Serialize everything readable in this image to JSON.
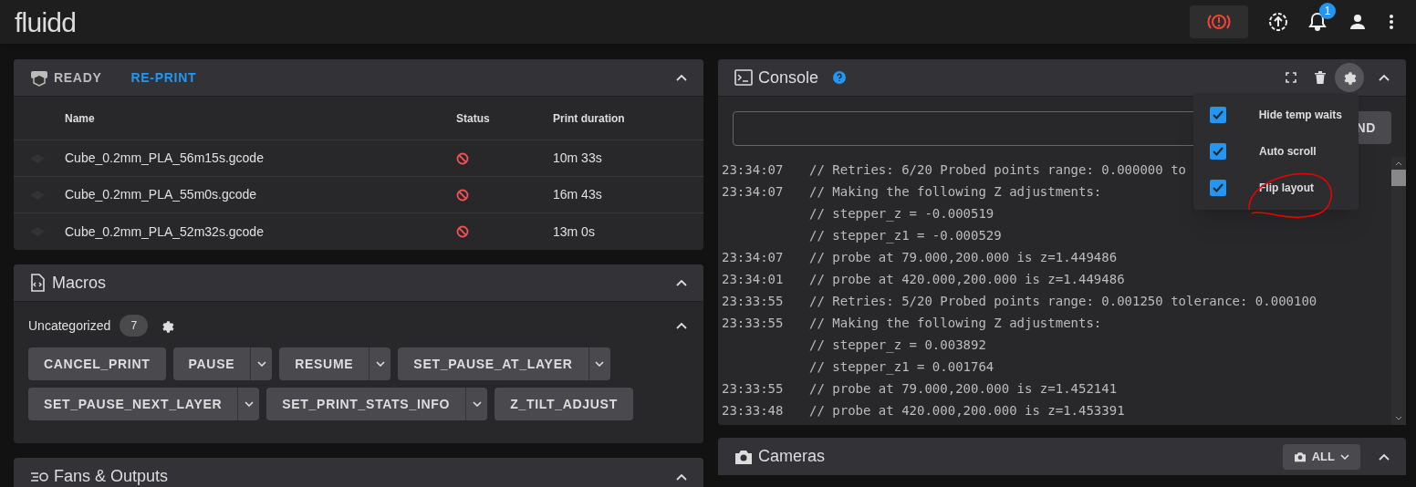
{
  "app_bar": {
    "logo": "fluidd",
    "notification_count": "1"
  },
  "status_card": {
    "title": "READY",
    "action": "RE-PRINT",
    "columns": [
      "Name",
      "Status",
      "Print duration"
    ],
    "rows": [
      {
        "name": "Cube_0.2mm_PLA_56m15s.gcode",
        "duration": "10m 33s"
      },
      {
        "name": "Cube_0.2mm_PLA_55m0s.gcode",
        "duration": "16m 43s"
      },
      {
        "name": "Cube_0.2mm_PLA_52m32s.gcode",
        "duration": "13m 0s"
      }
    ]
  },
  "macros": {
    "title": "Macros",
    "category": "Uncategorized",
    "count": "7",
    "buttons": [
      {
        "label": "CANCEL_PRINT",
        "menu": false
      },
      {
        "label": "PAUSE",
        "menu": true
      },
      {
        "label": "RESUME",
        "menu": true
      },
      {
        "label": "SET_PAUSE_AT_LAYER",
        "menu": true
      },
      {
        "label": "SET_PAUSE_NEXT_LAYER",
        "menu": true
      },
      {
        "label": "SET_PRINT_STATS_INFO",
        "menu": true
      },
      {
        "label": "Z_TILT_ADJUST",
        "menu": false
      }
    ]
  },
  "fans": {
    "title": "Fans & Outputs"
  },
  "console": {
    "title": "Console",
    "send": "ND",
    "lines": [
      {
        "time": "23:34:07",
        "text": "// Retries: 6/20 Probed points range: 0.000000 to"
      },
      {
        "time": "23:34:07",
        "text": "// Making the following Z adjustments:"
      },
      {
        "text": "// stepper_z = -0.000519"
      },
      {
        "text": "// stepper_z1 = -0.000529"
      },
      {
        "time": "23:34:07",
        "text": "// probe at 79.000,200.000 is z=1.449486"
      },
      {
        "time": "23:34:01",
        "text": "// probe at 420.000,200.000 is z=1.449486"
      },
      {
        "time": "23:33:55",
        "text": "// Retries: 5/20 Probed points range: 0.001250 tolerance: 0.000100"
      },
      {
        "time": "23:33:55",
        "text": "// Making the following Z adjustments:"
      },
      {
        "text": "// stepper_z = 0.003892"
      },
      {
        "text": "// stepper_z1 = 0.001764"
      },
      {
        "time": "23:33:55",
        "text": "// probe at 79.000,200.000 is z=1.452141"
      },
      {
        "time": "23:33:48",
        "text": "// probe at 420.000,200.000 is z=1.453391"
      }
    ],
    "menu": [
      {
        "label": "Hide temp waits",
        "checked": true
      },
      {
        "label": "Auto scroll",
        "checked": true
      },
      {
        "label": "Flip layout",
        "checked": true
      }
    ]
  },
  "cameras": {
    "title": "Cameras",
    "filter": "ALL"
  }
}
